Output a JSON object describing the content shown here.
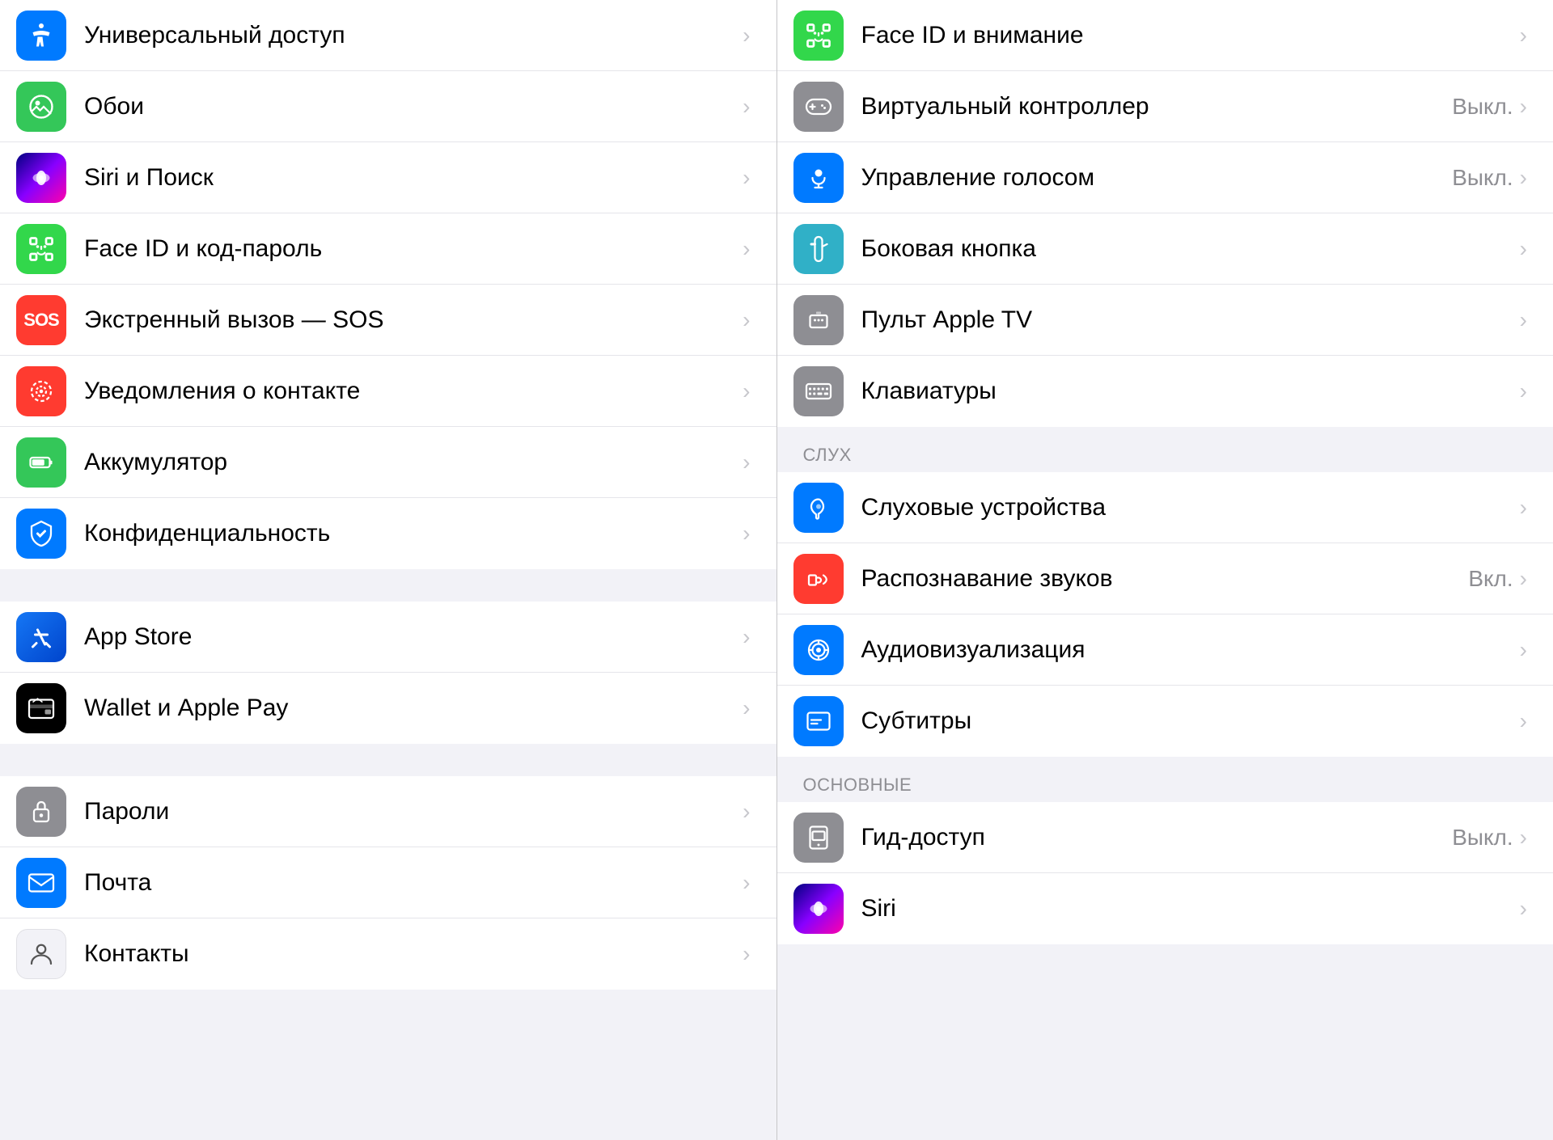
{
  "left_column": {
    "groups": [
      {
        "items": [
          {
            "id": "universal-access",
            "label": "Универсальный доступ",
            "icon_color": "icon-blue",
            "icon_type": "universal",
            "chevron": true
          },
          {
            "id": "wallpaper",
            "label": "Обои",
            "icon_color": "icon-green",
            "icon_type": "wallpaper",
            "chevron": true
          },
          {
            "id": "siri",
            "label": "Siri и Поиск",
            "icon_color": "icon-siri",
            "icon_type": "siri",
            "chevron": true
          },
          {
            "id": "face-id",
            "label": "Face ID и код-пароль",
            "icon_color": "icon-face-id-green",
            "icon_type": "faceid",
            "chevron": true
          },
          {
            "id": "sos",
            "label": "Экстренный вызов — SOS",
            "icon_color": "icon-sos",
            "icon_type": "sos",
            "chevron": true
          },
          {
            "id": "contact-notif",
            "label": "Уведомления о контакте",
            "icon_color": "icon-contact-notif",
            "icon_type": "contact",
            "chevron": true
          },
          {
            "id": "battery",
            "label": "Аккумулятор",
            "icon_color": "icon-battery",
            "icon_type": "battery",
            "chevron": true
          },
          {
            "id": "privacy",
            "label": "Конфиденциальность",
            "icon_color": "icon-privacy",
            "icon_type": "privacy",
            "chevron": true
          }
        ]
      },
      {
        "items": [
          {
            "id": "appstore",
            "label": "App Store",
            "icon_color": "icon-appstore",
            "icon_type": "appstore",
            "chevron": true
          },
          {
            "id": "wallet",
            "label": "Wallet и Apple Pay",
            "icon_color": "icon-wallet",
            "icon_type": "wallet",
            "chevron": true
          }
        ]
      },
      {
        "items": [
          {
            "id": "passwords",
            "label": "Пароли",
            "icon_color": "icon-passwords",
            "icon_type": "passwords",
            "chevron": true
          },
          {
            "id": "mail",
            "label": "Почта",
            "icon_color": "icon-mail",
            "icon_type": "mail",
            "chevron": true
          },
          {
            "id": "contacts",
            "label": "Контакты",
            "icon_color": "icon-contacts",
            "icon_type": "contacts",
            "chevron": true
          }
        ]
      }
    ]
  },
  "right_column": {
    "groups": [
      {
        "items": [
          {
            "id": "face-id-right",
            "label": "Face ID и внимание",
            "icon_color": "icon-face-id-right",
            "icon_type": "faceid",
            "chevron": true
          },
          {
            "id": "gamepad",
            "label": "Виртуальный контроллер",
            "icon_color": "icon-gamepad",
            "icon_type": "gamepad",
            "value": "Выкл.",
            "chevron": true
          },
          {
            "id": "voice-control",
            "label": "Управление голосом",
            "icon_color": "icon-voice",
            "icon_type": "voice",
            "value": "Выкл.",
            "chevron": true
          },
          {
            "id": "side-button",
            "label": "Боковая кнопка",
            "icon_color": "icon-side-btn",
            "icon_type": "sidebtn",
            "chevron": true
          },
          {
            "id": "apple-tv",
            "label": "Пульт Apple TV",
            "icon_color": "icon-apple-tv",
            "icon_type": "appletv",
            "chevron": true
          },
          {
            "id": "keyboards",
            "label": "Клавиатуры",
            "icon_color": "icon-keyboard",
            "icon_type": "keyboard",
            "chevron": true
          }
        ]
      },
      {
        "section_header": "СЛУХ",
        "items": [
          {
            "id": "hearing-devices",
            "label": "Слуховые устройства",
            "icon_color": "icon-hearing",
            "icon_type": "hearing",
            "chevron": true
          },
          {
            "id": "sound-recognition",
            "label": "Распознавание звуков",
            "icon_color": "icon-sound-rec",
            "icon_type": "soundrec",
            "value": "Вкл.",
            "chevron": true
          },
          {
            "id": "audio-vis",
            "label": "Аудиовизуализация",
            "icon_color": "icon-audio-vis",
            "icon_type": "audiovis",
            "chevron": true
          },
          {
            "id": "subtitles",
            "label": "Субтитры",
            "icon_color": "icon-subtitles",
            "icon_type": "subtitles",
            "chevron": true
          }
        ]
      },
      {
        "section_header": "ОСНОВНЫЕ",
        "items": [
          {
            "id": "guided-access",
            "label": "Гид-доступ",
            "icon_color": "icon-guided-access",
            "icon_type": "guidedaccess",
            "value": "Выкл.",
            "chevron": true
          },
          {
            "id": "siri-right",
            "label": "Siri",
            "icon_color": "icon-siri-right",
            "icon_type": "siri",
            "chevron": true
          }
        ]
      }
    ]
  }
}
